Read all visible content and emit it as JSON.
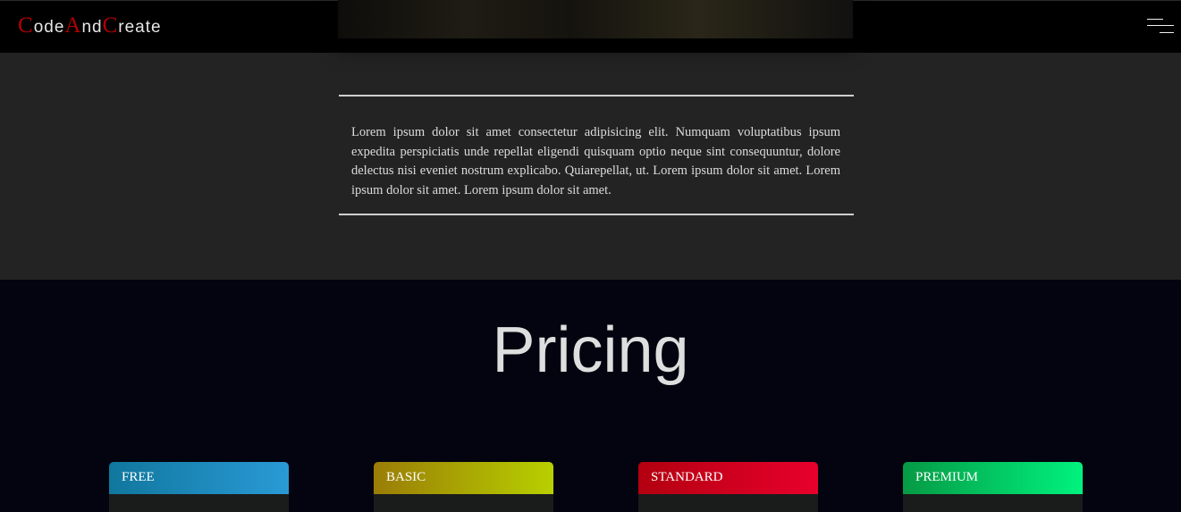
{
  "nav": {
    "logo": [
      {
        "text": "C",
        "cap": true
      },
      {
        "text": "ode",
        "cap": false
      },
      {
        "text": "A",
        "cap": true
      },
      {
        "text": "nd",
        "cap": false
      },
      {
        "text": "C",
        "cap": true
      },
      {
        "text": "reate",
        "cap": false
      }
    ],
    "menu_icon": "hamburger-menu-icon"
  },
  "about": {
    "body": "Lorem ipsum dolor sit amet consectetur adipisicing elit. Numquam voluptatibus ipsum expedita perspiciatis unde repellat eligendi quisquam optio neque sint consequuntur, dolore delectus nisi eveniet nostrum explicabo. Quiarepellat, ut. Lorem ipsum dolor sit amet. Lorem ipsum dolor sit amet. Lorem ipsum dolor sit amet."
  },
  "pricing": {
    "title": "Pricing",
    "plans": [
      {
        "name": "FREE",
        "color_start": "#10779d",
        "color_end": "#2a9ad6"
      },
      {
        "name": "BASIC",
        "color_start": "#9a7c07",
        "color_end": "#b8d000"
      },
      {
        "name": "STANDARD",
        "color_start": "#b30010",
        "color_end": "#e8002c"
      },
      {
        "name": "PREMIUM",
        "color_start": "#069a45",
        "color_end": "#00f27e"
      }
    ]
  },
  "colors": {
    "brand_accent": "#b30000",
    "nav_background": "#000000",
    "about_background": "#242323",
    "pricing_background": "#03040f"
  }
}
